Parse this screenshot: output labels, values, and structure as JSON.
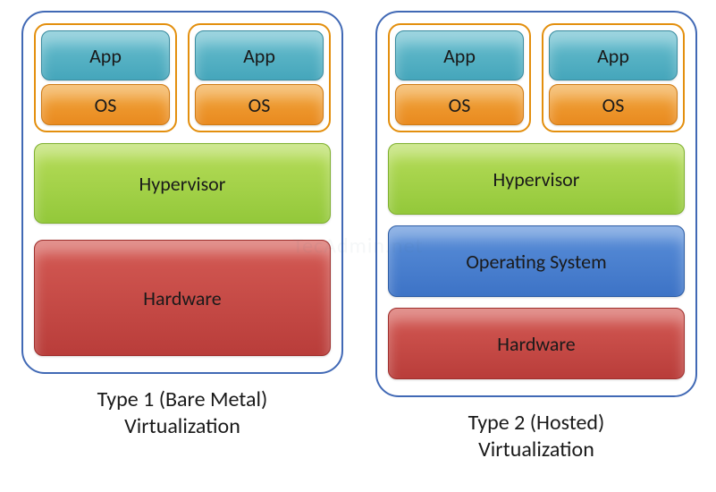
{
  "type1": {
    "title_line1": "Type 1 (Bare Metal)",
    "title_line2": "Virtualization",
    "vms": [
      {
        "app": "App",
        "os": "OS"
      },
      {
        "app": "App",
        "os": "OS"
      }
    ],
    "layers": [
      {
        "kind": "hypervisor",
        "label": "Hypervisor"
      },
      {
        "kind": "hardware",
        "label": "Hardware"
      }
    ]
  },
  "type2": {
    "title_line1": "Type 2 (Hosted)",
    "title_line2": "Virtualization",
    "vms": [
      {
        "app": "App",
        "os": "OS"
      },
      {
        "app": "App",
        "os": "OS"
      }
    ],
    "layers": [
      {
        "kind": "hypervisor",
        "label": "Hypervisor"
      },
      {
        "kind": "host_os",
        "label": "Operating  System"
      },
      {
        "kind": "hardware",
        "label": "Hardware"
      }
    ]
  },
  "colors": {
    "app": "#45a6bb",
    "os": "#e98a1f",
    "hypervisor": "#93c83a",
    "host_os": "#3d73c6",
    "hardware": "#b93d3a",
    "panel_border": "#4169b5",
    "vm_border": "#e38f0e"
  },
  "watermark": "TecAdmin.net"
}
